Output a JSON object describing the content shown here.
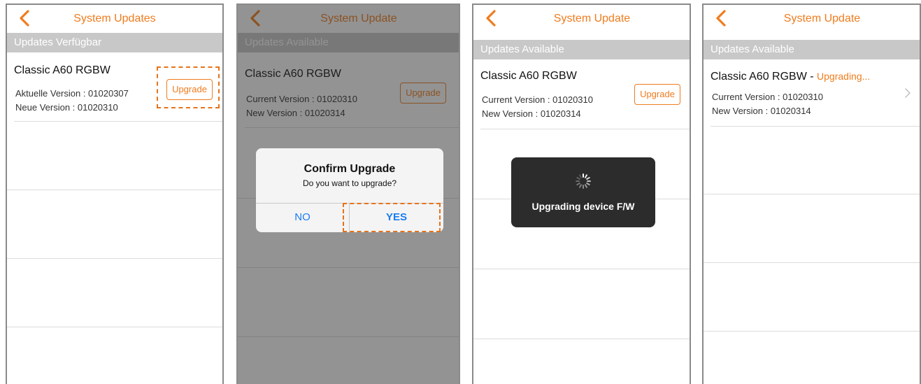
{
  "accent_color": "#f07c1e",
  "screens": [
    {
      "nav_title": "System Updates",
      "section": "Updates Verfügbar",
      "device": "Classic A60 RGBW",
      "current_version": "Aktuelle Version : 01020307",
      "new_version": "Neue Version : 01020310",
      "upgrade_button": "Upgrade"
    },
    {
      "nav_title": "System Update",
      "section": "Updates Available",
      "device": "Classic A60 RGBW",
      "current_version": "Current Version : 01020310",
      "new_version": "New Version : 01020314",
      "upgrade_button": "Upgrade",
      "dialog": {
        "title": "Confirm Upgrade",
        "message": "Do you want to upgrade?",
        "no_label": "NO",
        "yes_label": "YES"
      }
    },
    {
      "nav_title": "System Update",
      "section": "Updates Available",
      "device": "Classic A60 RGBW",
      "current_version": "Current Version : 01020310",
      "new_version": "New Version : 01020314",
      "upgrade_button": "Upgrade",
      "hud_text": "Upgrading device F/W"
    },
    {
      "nav_title": "System Update",
      "section": "Updates Available",
      "device": "Classic A60 RGBW",
      "device_separator": " - ",
      "status": "Upgrading...",
      "current_version": "Current Version : 01020310",
      "new_version": "New Version : 01020314"
    }
  ]
}
